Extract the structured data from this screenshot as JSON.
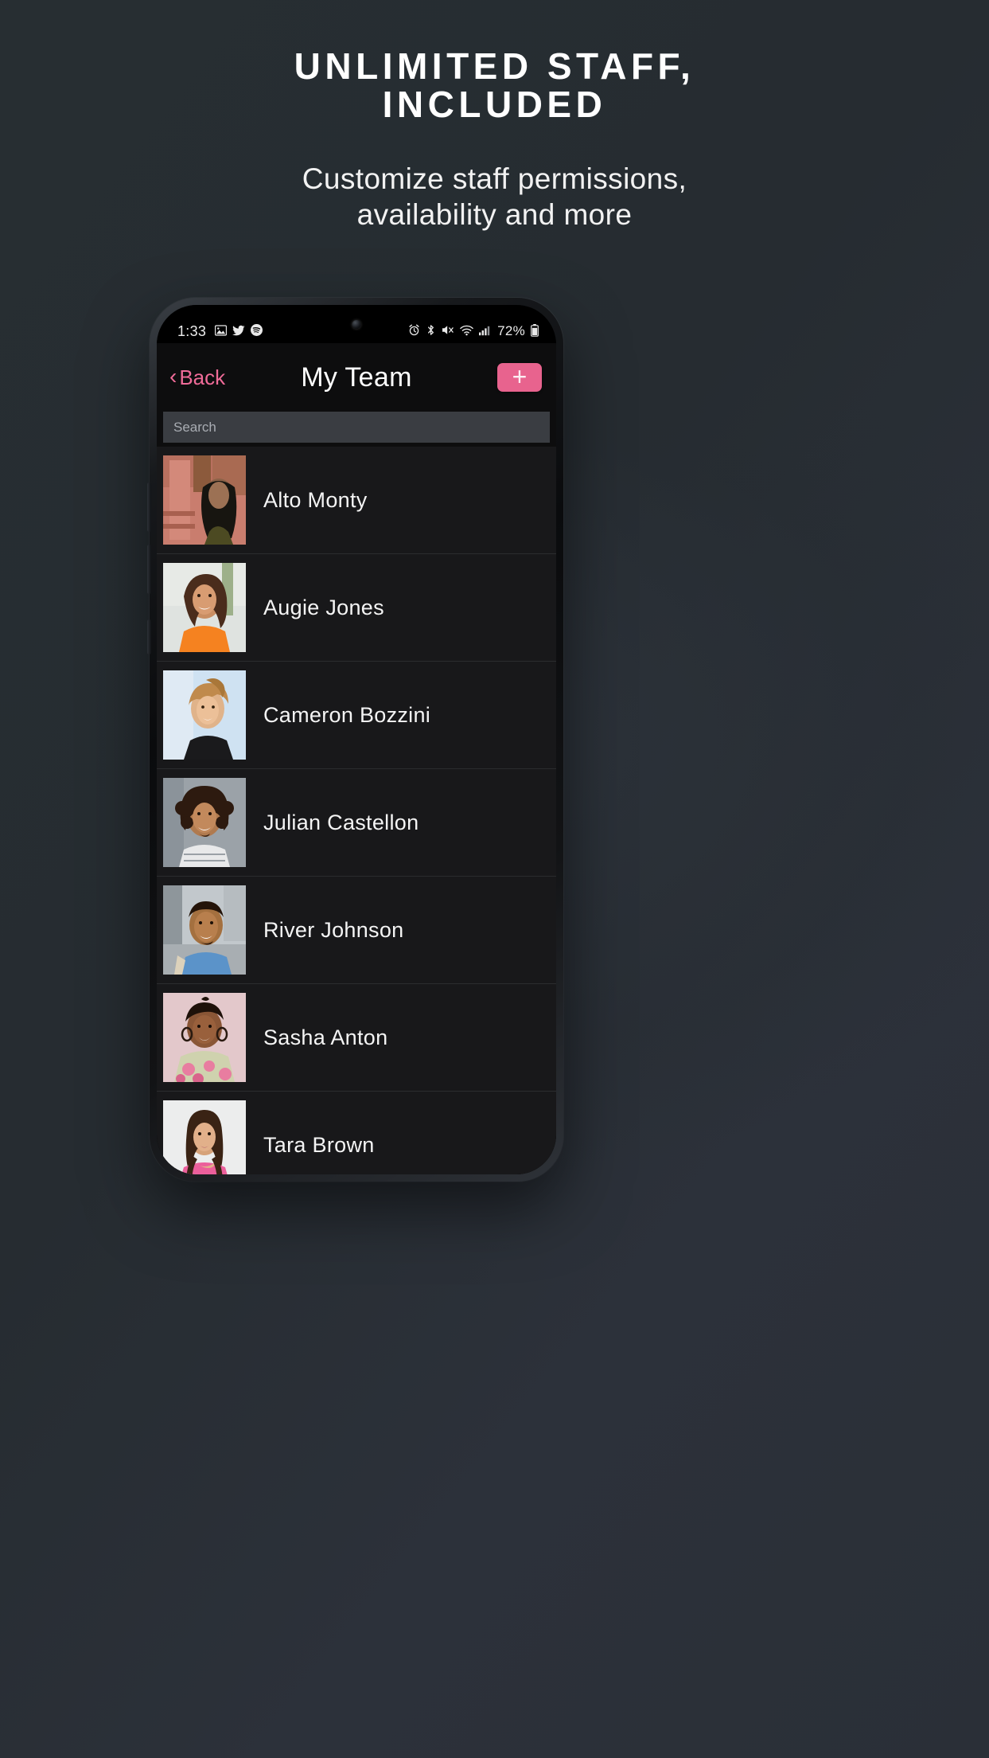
{
  "promo": {
    "title_line1": "UNLIMITED STAFF,",
    "title_line2": "INCLUDED",
    "subtitle_line1": "Customize staff permissions,",
    "subtitle_line2": "availability and more"
  },
  "phone": {
    "status_bar": {
      "time": "1:33",
      "left_icons": [
        "gallery-icon",
        "twitter-icon",
        "spotify-icon"
      ],
      "right_icons": [
        "alarm-icon",
        "bluetooth-icon",
        "mute-icon",
        "wifi-icon",
        "cellular-signal-icon"
      ],
      "battery_percent": "72%",
      "battery_icon": "battery-icon"
    },
    "nav_bar": {
      "back_label": "Back",
      "back_icon": "chevron-left-icon",
      "title": "My Team",
      "add_label": "+",
      "add_icon": "plus-icon"
    },
    "search": {
      "placeholder": "Search",
      "value": ""
    },
    "team_list": [
      {
        "name": "Alto Monty",
        "avatar": "photo-alto-monty"
      },
      {
        "name": "Augie Jones",
        "avatar": "photo-augie-jones"
      },
      {
        "name": "Cameron Bozzini",
        "avatar": "photo-cameron-bozzini"
      },
      {
        "name": "Julian Castellon",
        "avatar": "photo-julian-castellon"
      },
      {
        "name": "River Johnson",
        "avatar": "photo-river-johnson"
      },
      {
        "name": "Sasha Anton",
        "avatar": "photo-sasha-anton"
      },
      {
        "name": "Tara Brown",
        "avatar": "photo-tara-brown"
      }
    ]
  },
  "colors": {
    "background": "#262d31",
    "accent_pink": "#e8638e",
    "back_link": "#ef6b98",
    "screen_black": "#0d0d0e",
    "row_background": "#18181a",
    "search_field": "#3a3d42"
  }
}
